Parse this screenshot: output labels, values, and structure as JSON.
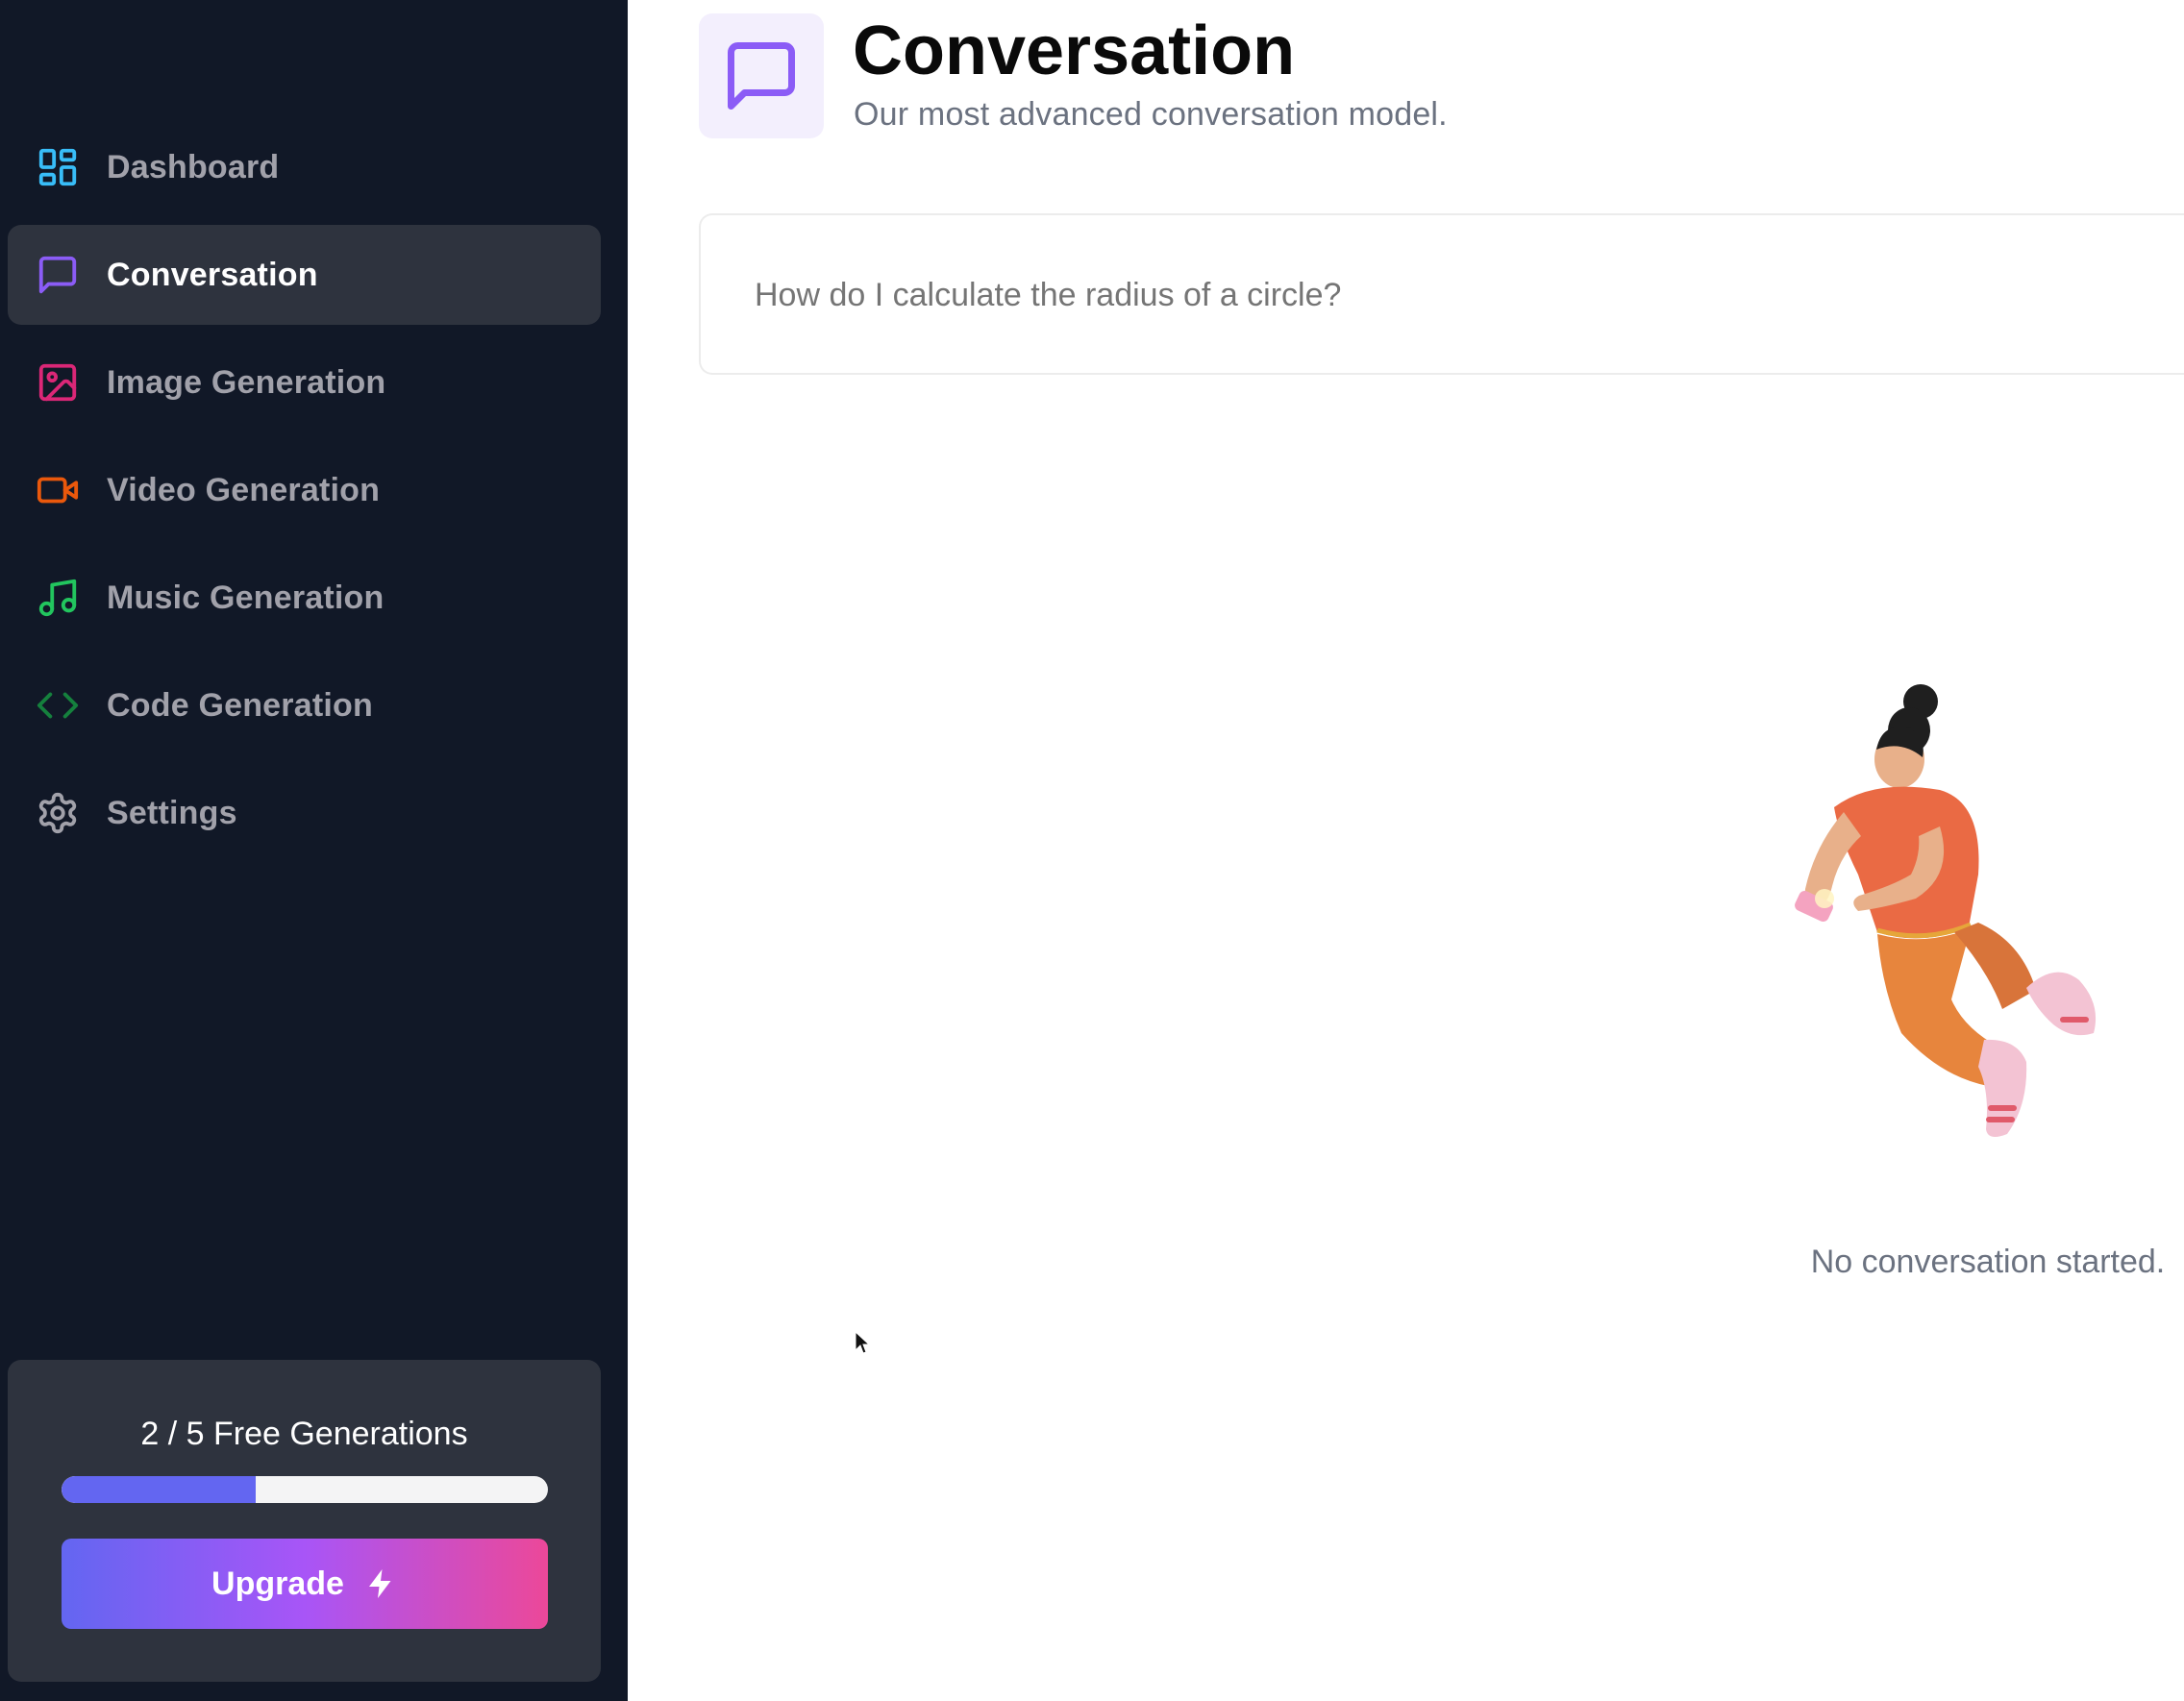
{
  "sidebar": {
    "items": [
      {
        "label": "Dashboard",
        "icon": "layout-dashboard-icon",
        "color": "#38bdf8"
      },
      {
        "label": "Conversation",
        "icon": "message-square-icon",
        "color": "#8b5cf6"
      },
      {
        "label": "Image Generation",
        "icon": "image-icon",
        "color": "#db2777"
      },
      {
        "label": "Video Generation",
        "icon": "video-icon",
        "color": "#ea580c"
      },
      {
        "label": "Music Generation",
        "icon": "music-icon",
        "color": "#22c55e"
      },
      {
        "label": "Code Generation",
        "icon": "code-icon",
        "color": "#15803d"
      },
      {
        "label": "Settings",
        "icon": "settings-icon",
        "color": "#a1a1aa"
      }
    ],
    "active_item": "Conversation"
  },
  "usage": {
    "text": "2 / 5 Free Generations",
    "used": 2,
    "limit": 5,
    "progress_fraction": 0.4,
    "progress_color": "#6366f1",
    "upgrade_label": "Upgrade",
    "upgrade_icon": "zap-icon"
  },
  "header": {
    "icon": "message-square-icon",
    "icon_color": "#8b5cf6",
    "title": "Conversation",
    "subtitle": "Our most advanced conversation model."
  },
  "prompt": {
    "value": "",
    "placeholder": "How do I calculate the radius of a circle?"
  },
  "empty_state": {
    "illustration": "person-with-phone-illustration",
    "text": "No conversation started."
  }
}
